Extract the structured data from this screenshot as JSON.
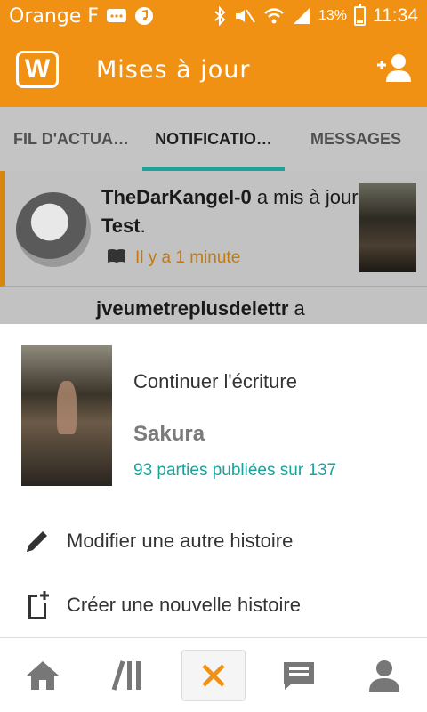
{
  "statusbar": {
    "carrier": "Orange F",
    "battery": "13%",
    "time": "11:34",
    "icons": [
      "message-icon",
      "music-icon",
      "bluetooth-icon",
      "mute-icon",
      "wifi-icon",
      "signal-icon",
      "battery-icon"
    ]
  },
  "appbar": {
    "logo": "W",
    "title": "Mises à jour",
    "add_user_icon": "add-person-icon"
  },
  "tabs": [
    {
      "label": "FIL D'ACTUA…"
    },
    {
      "label": "NOTIFICATIO…"
    },
    {
      "label": "MESSAGES"
    }
  ],
  "feed": {
    "items": [
      {
        "user": "TheDarKangel-0",
        "action": " a mis à jour ",
        "story": "Test",
        "suffix": ".",
        "time": "Il y a 1 minute"
      },
      {
        "user": "jveumetreplusdelettr",
        "action": " a"
      }
    ]
  },
  "sheet": {
    "continue_label": "Continuer l'écriture",
    "story_title": "Sakura",
    "story_parts": "93 parties publiées sur 137",
    "edit_label": "Modifier une autre histoire",
    "create_label": "Créer une nouvelle histoire"
  },
  "bottomnav": {
    "items": [
      "home-icon",
      "library-icon",
      "close-icon",
      "messages-icon",
      "profile-icon"
    ]
  },
  "colors": {
    "brand": "#f09113",
    "accent": "#1aa29b",
    "timestamp": "#c4790d"
  }
}
